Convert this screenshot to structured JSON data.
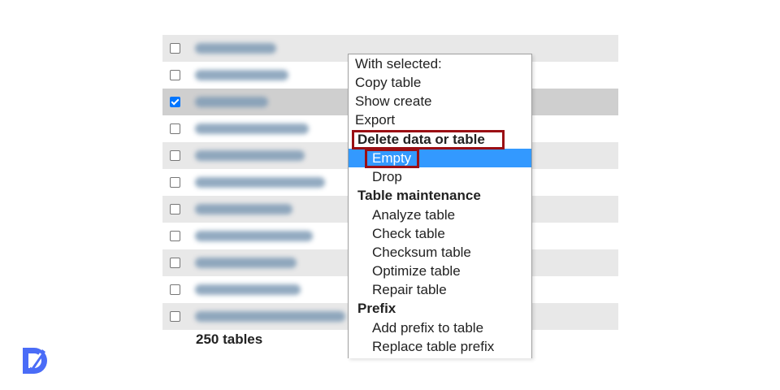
{
  "tables": {
    "rows": [
      {
        "checked": false,
        "blur_width": 100
      },
      {
        "checked": false,
        "blur_width": 115
      },
      {
        "checked": true,
        "blur_width": 90
      },
      {
        "checked": false,
        "blur_width": 140
      },
      {
        "checked": false,
        "blur_width": 135
      },
      {
        "checked": false,
        "blur_width": 160
      },
      {
        "checked": false,
        "blur_width": 120
      },
      {
        "checked": false,
        "blur_width": 145
      },
      {
        "checked": false,
        "blur_width": 125
      },
      {
        "checked": false,
        "blur_width": 130
      },
      {
        "checked": false,
        "blur_width": 185
      }
    ],
    "count_label": "250 tables"
  },
  "context_menu": {
    "items": [
      {
        "label": "With selected:",
        "kind": "title"
      },
      {
        "label": "Copy table",
        "kind": "item"
      },
      {
        "label": "Show create",
        "kind": "item"
      },
      {
        "label": "Export",
        "kind": "item"
      },
      {
        "label": "Delete data or table",
        "kind": "header"
      },
      {
        "label": "Empty",
        "kind": "subitem",
        "highlighted": true
      },
      {
        "label": "Drop",
        "kind": "subitem"
      },
      {
        "label": "Table maintenance",
        "kind": "header"
      },
      {
        "label": "Analyze table",
        "kind": "subitem"
      },
      {
        "label": "Check table",
        "kind": "subitem"
      },
      {
        "label": "Checksum table",
        "kind": "subitem"
      },
      {
        "label": "Optimize table",
        "kind": "subitem"
      },
      {
        "label": "Repair table",
        "kind": "subitem"
      },
      {
        "label": "Prefix",
        "kind": "header"
      },
      {
        "label": "Add prefix to table",
        "kind": "subitem"
      },
      {
        "label": "Replace table prefix",
        "kind": "subitem"
      }
    ]
  },
  "colors": {
    "highlight": "#3399ff",
    "annotation_box": "#9a0f14",
    "checkbox_checked": "#0075ff",
    "brand": "#4a6cf7"
  }
}
